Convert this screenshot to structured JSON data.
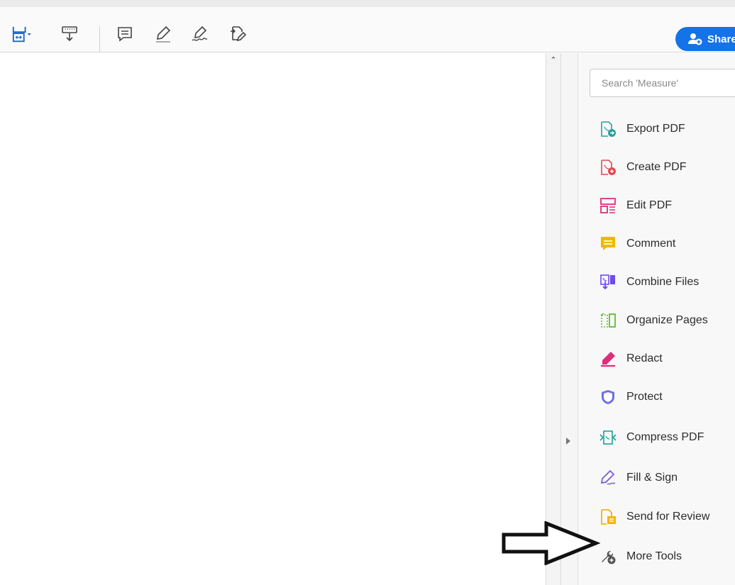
{
  "toolbar": {
    "share_label": "Share",
    "icons": [
      "measure-icon",
      "stamp-icon",
      "comment-icon",
      "highlight-icon",
      "sign-icon",
      "send-for-review-icon"
    ]
  },
  "right_pane": {
    "search": {
      "placeholder": "Search 'Measure'",
      "value": ""
    },
    "tools": [
      {
        "label": "Export PDF",
        "icon": "export-pdf-icon",
        "color": "#26a1a1"
      },
      {
        "label": "Create PDF",
        "icon": "create-pdf-icon",
        "color": "#e34850"
      },
      {
        "label": "Edit PDF",
        "icon": "edit-pdf-icon",
        "color": "#d9307c"
      },
      {
        "label": "Comment",
        "icon": "comment-icon",
        "color": "#f2b705"
      },
      {
        "label": "Combine Files",
        "icon": "combine-files-icon",
        "color": "#6e4cea"
      },
      {
        "label": "Organize Pages",
        "icon": "organize-pages-icon",
        "color": "#5fbf2b"
      },
      {
        "label": "Redact",
        "icon": "redact-icon",
        "color": "#d9307c"
      },
      {
        "label": "Protect",
        "icon": "protect-icon",
        "color": "#6e6ee8"
      },
      {
        "label": "Compress PDF",
        "icon": "compress-pdf-icon",
        "color": "#1aa39a"
      },
      {
        "label": "Fill & Sign",
        "icon": "fill-sign-icon",
        "color": "#7a5cdb"
      },
      {
        "label": "Send for Review",
        "icon": "send-for-review-icon",
        "color": "#f2b705"
      },
      {
        "label": "More Tools",
        "icon": "more-tools-icon",
        "color": "#555555"
      }
    ]
  },
  "colors": {
    "accent": "#1473e6",
    "toolbar_icon": "#1b67c8"
  }
}
